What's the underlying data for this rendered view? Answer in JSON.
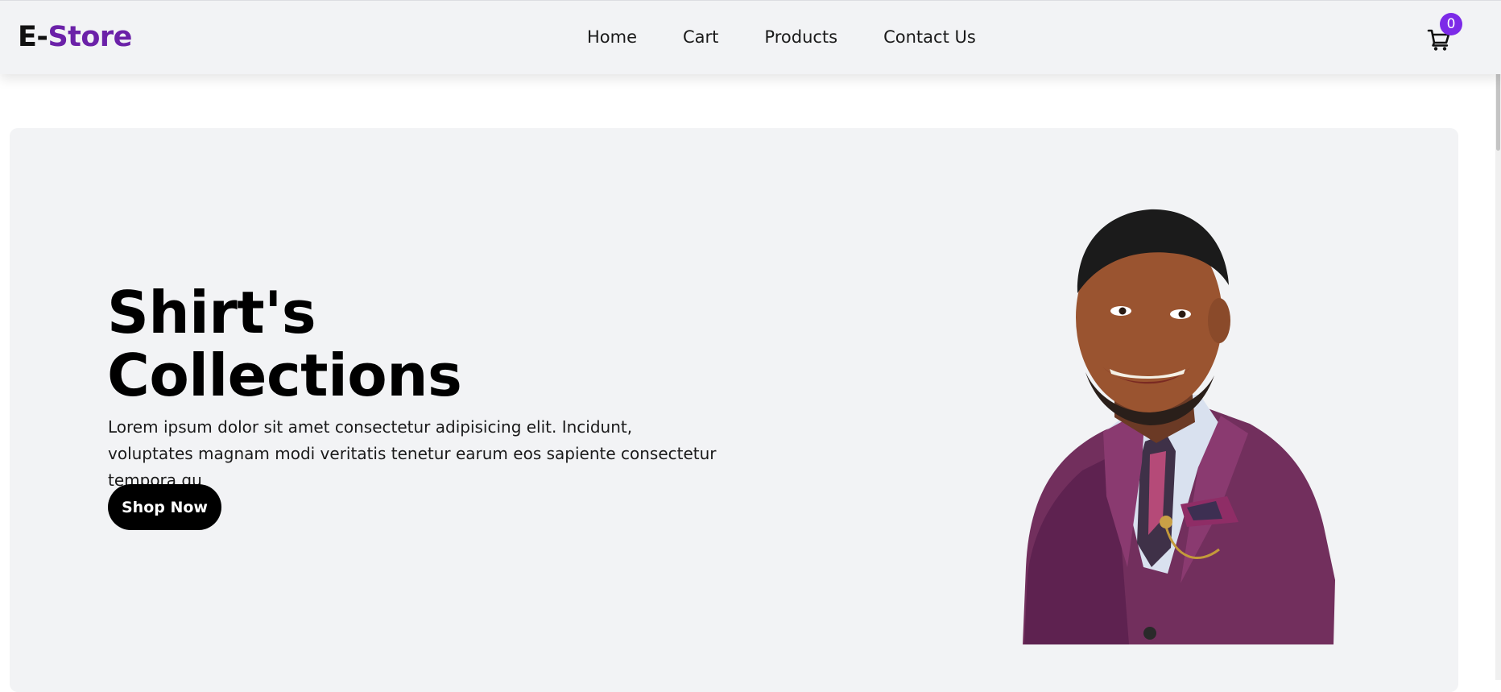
{
  "brand": {
    "prefix": "E-",
    "accent": "Store",
    "accent_color": "#6b21a8"
  },
  "nav": {
    "links": [
      "Home",
      "Cart",
      "Products",
      "Contact Us"
    ]
  },
  "cart": {
    "icon": "shopping-cart-icon",
    "count": "0",
    "badge_color": "#7c2ae8"
  },
  "hero": {
    "title_line_1": "Shirt's",
    "title_line_2": "Collections",
    "description": "Lorem ipsum dolor sit amet consectetur adipisicing elit. Incidunt, voluptates magnam modi veritatis tenetur earum eos sapiente consectetur tempora qu",
    "cta_label": "Shop Now",
    "image": "smiling man in burgundy suit with patterned tie and pocket square"
  }
}
